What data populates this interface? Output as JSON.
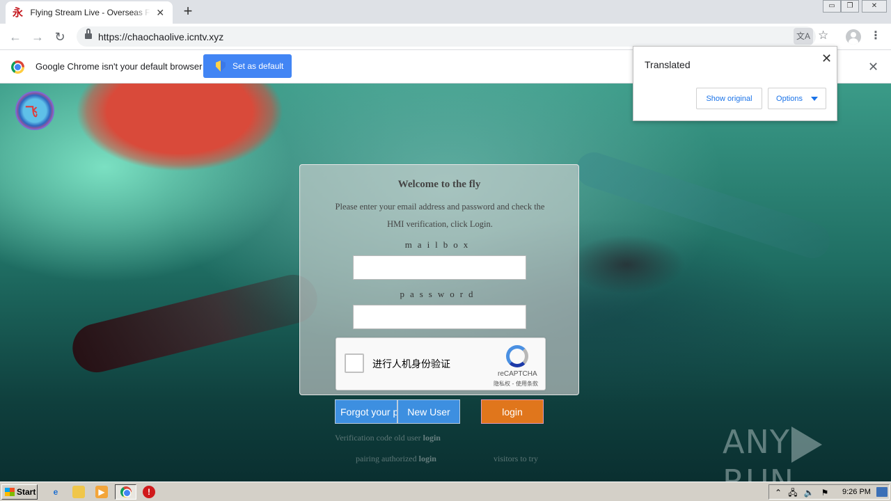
{
  "browser": {
    "tab_title": "Flying Stream Live - Overseas Full HD",
    "tab_close": "✕",
    "new_tab": "+",
    "url": "https://chaochaolive.icntv.xyz",
    "window_controls": [
      "▭",
      "❐",
      "✕"
    ]
  },
  "infobar": {
    "message": "Google Chrome isn't your default browser",
    "button": "Set as default",
    "close": "✕"
  },
  "translate_popup": {
    "title": "Translated",
    "show_original": "Show original",
    "options": "Options",
    "close": "✕"
  },
  "login": {
    "logo_text": "飞",
    "title": "Welcome to the fly",
    "instructions": "Please enter your email address and password and check the HMI verification, click Login.",
    "mailbox_label": "mailbox",
    "password_label": "password",
    "mailbox_value": "",
    "password_value": "",
    "recaptcha_label": "进行人机身份验证",
    "recaptcha_brand": "reCAPTCHA",
    "recaptcha_terms": "隐私权 - 使用条款",
    "forgot_button": "Forgot your password",
    "new_user_button": "New User",
    "login_button": "login",
    "link_verification_prefix": "Verification code old user",
    "link_verification_bold": "login",
    "link_pairing_prefix": "pairing authorized",
    "link_pairing_bold": "login",
    "link_visitors": "visitors to try"
  },
  "watermark": {
    "left": "ANY",
    "right": "RUN"
  },
  "taskbar": {
    "start": "Start",
    "clock": "9:26 PM"
  },
  "colors": {
    "chrome_blue": "#4285f4",
    "login_orange": "#e0761c",
    "button_blue": "#3d8fe0"
  }
}
